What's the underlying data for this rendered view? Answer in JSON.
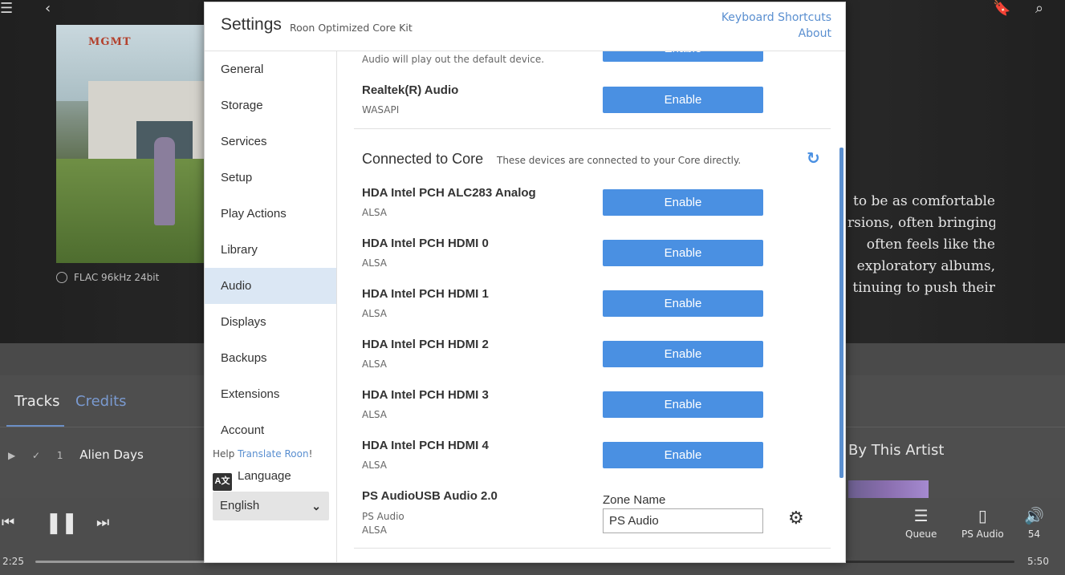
{
  "background": {
    "album_logo": "MGMT",
    "format": "FLAC 96kHz 24bit",
    "bio_lines": [
      "to be as comfortable",
      "rsions, often bringing",
      "often feels like the",
      "exploratory albums,",
      "tinuing to push their"
    ],
    "tabs": {
      "tracks": "Tracks",
      "credits": "Credits"
    },
    "track": {
      "number": "1",
      "name": "Alien Days"
    },
    "by_artist": "By This Artist",
    "player": {
      "time_start": "2:25",
      "time_end": "5:50",
      "progress": 0.41,
      "queue_label": "Queue",
      "zone_label": "PS Audio",
      "volume_label": "54"
    }
  },
  "settings": {
    "title": "Settings",
    "subtitle": "Roon Optimized Core Kit",
    "keyboard_shortcuts": "Keyboard Shortcuts",
    "about": "About",
    "nav": [
      "General",
      "Storage",
      "Services",
      "Setup",
      "Play Actions",
      "Library",
      "Audio",
      "Displays",
      "Backups",
      "Extensions",
      "Account"
    ],
    "active_nav": "Audio",
    "help_prefix": "Help ",
    "help_link": "Translate Roon",
    "help_suffix": "!",
    "language_label": "Language",
    "language_value": "English",
    "partial_device": {
      "sub": "Audio will play out the default device.",
      "button": "Enable"
    },
    "local_device": {
      "name": "Realtek(R) Audio",
      "sub": "WASAPI",
      "button": "Enable"
    },
    "section": {
      "title": "Connected to Core",
      "desc": "These devices are connected to your Core directly."
    },
    "devices": [
      {
        "name": "HDA Intel PCH ALC283 Analog",
        "sub": "ALSA",
        "button": "Enable"
      },
      {
        "name": "HDA Intel PCH HDMI 0",
        "sub": "ALSA",
        "button": "Enable"
      },
      {
        "name": "HDA Intel PCH HDMI 1",
        "sub": "ALSA",
        "button": "Enable"
      },
      {
        "name": "HDA Intel PCH HDMI 2",
        "sub": "ALSA",
        "button": "Enable"
      },
      {
        "name": "HDA Intel PCH HDMI 3",
        "sub": "ALSA",
        "button": "Enable"
      },
      {
        "name": "HDA Intel PCH HDMI 4",
        "sub": "ALSA",
        "button": "Enable"
      }
    ],
    "enabled_device": {
      "name": "PS AudioUSB Audio 2.0",
      "sub1": "PS Audio",
      "sub2": "ALSA",
      "zone_label": "Zone Name",
      "zone_value": "PS Audio"
    }
  }
}
